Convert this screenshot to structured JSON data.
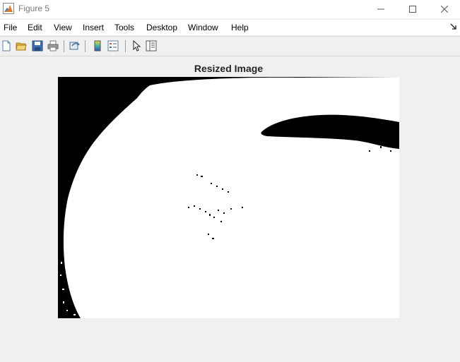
{
  "window": {
    "title": "Figure 5",
    "controls": [
      "minimize",
      "maximize",
      "close"
    ]
  },
  "menu": {
    "items": [
      "File",
      "Edit",
      "View",
      "Insert",
      "Tools",
      "Desktop",
      "Window",
      "Help"
    ]
  },
  "toolbar": {
    "buttons": [
      {
        "icon": "new-figure-icon"
      },
      {
        "icon": "open-file-icon"
      },
      {
        "icon": "save-icon"
      },
      {
        "icon": "print-icon"
      },
      {
        "icon": "link-plot-icon"
      },
      {
        "icon": "colorbar-icon"
      },
      {
        "icon": "legend-icon"
      },
      {
        "icon": "pointer-icon"
      },
      {
        "icon": "property-inspector-icon"
      }
    ]
  },
  "axes": {
    "title": "Resized Image",
    "image_type": "binary black-and-white image"
  },
  "colors": {
    "foreground": "#ffffff",
    "background": "#000000",
    "window_bg": "#f0f0f0",
    "title_text": "#262626"
  }
}
